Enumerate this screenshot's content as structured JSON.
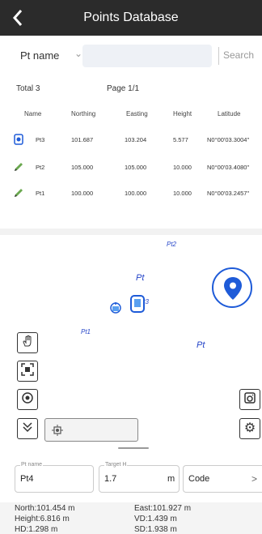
{
  "header": {
    "title": "Points Database",
    "back_icon": "back-arrow-icon"
  },
  "search": {
    "field": "Pt name",
    "placeholder": "",
    "button": "Search"
  },
  "summary": {
    "total": "Total 3",
    "page": "Page 1/1"
  },
  "table": {
    "columns": [
      "Name",
      "Northing",
      "Easting",
      "Height",
      "Latitude"
    ],
    "rows": [
      {
        "icon": "base-station-icon",
        "name": "Pt3",
        "northing": "101.687",
        "easting": "103.204",
        "height": "5.577",
        "latitude": "N0°00'03.3004\""
      },
      {
        "icon": "pencil-icon",
        "name": "Pt2",
        "northing": "105.000",
        "easting": "105.000",
        "height": "10.000",
        "latitude": "N0°00'03.4080\""
      },
      {
        "icon": "pencil-icon",
        "name": "Pt1",
        "northing": "100.000",
        "easting": "100.000",
        "height": "10.000",
        "latitude": "N0°00'03.2457\""
      }
    ]
  },
  "map": {
    "labels": {
      "pt2": "Pt2",
      "pt_a": "Pt",
      "pt3": "Pt3",
      "pt1": "Pt1",
      "pt_b": "Pt"
    }
  },
  "form": {
    "name_label": "Pt name",
    "name_value": "Pt4",
    "target_label": "Target H",
    "target_value": "1.7",
    "target_unit": "m",
    "code_label": "Code"
  },
  "readout": {
    "north": "North:101.454 m",
    "east": "East:101.927 m",
    "height": "Height:6.816 m",
    "vd": "VD:1.439 m",
    "hd": "HD:1.298 m",
    "sd": "SD:1.938 m"
  },
  "colors": {
    "header_bg": "#2b2b2b",
    "accent_blue": "#1e5bd8",
    "pencil_green": "#6aa84f"
  }
}
